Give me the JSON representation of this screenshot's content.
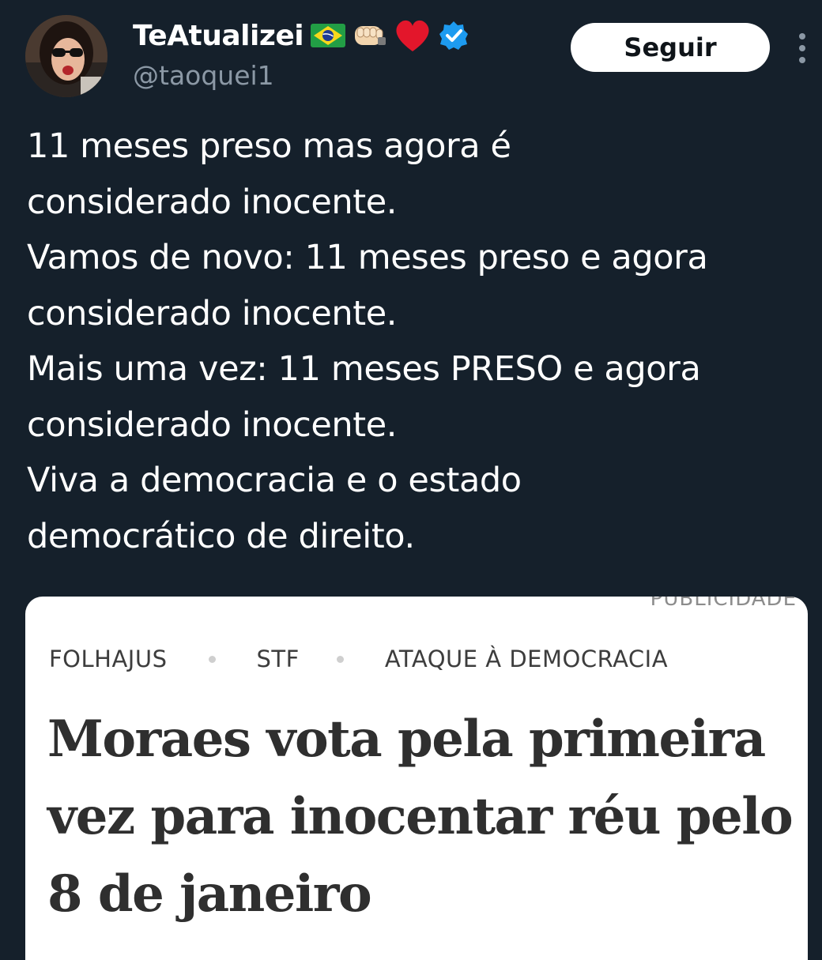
{
  "user": {
    "display_name": "TeAtualizei",
    "handle": "@taoquei1",
    "name_emojis": [
      "brazil-flag-icon",
      "fist-bump-icon",
      "red-heart-icon"
    ],
    "verified": true,
    "verified_color": "#1d9bf0"
  },
  "follow_button": {
    "label": "Seguir"
  },
  "tweet": {
    "text": "11 meses preso mas agora é\nconsiderado inocente.\nVamos de novo: 11 meses preso e agora\nconsiderado inocente.\nMais uma vez: 11 meses PRESO e agora\nconsiderado inocente.\nViva a democracia e o estado\ndemocrático de direito."
  },
  "article": {
    "ad_label": "PUBLICIDADE",
    "tags": [
      "FOLHAJUS",
      "STF",
      "ATAQUE À DEMOCRACIA"
    ],
    "headline": "Moraes vota pela primeira vez para inocentar réu pelo 8 de janeiro"
  },
  "colors": {
    "background": "#15202b",
    "text_primary": "#ffffff",
    "text_secondary": "#8b98a5",
    "button_bg": "#ffffff",
    "button_text": "#0f1419",
    "headline_text": "#2f2f2f"
  }
}
